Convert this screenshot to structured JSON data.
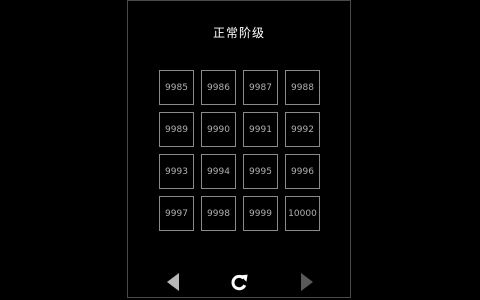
{
  "title": "正常阶级",
  "levels": [
    "9985",
    "9986",
    "9987",
    "9988",
    "9989",
    "9990",
    "9991",
    "9992",
    "9993",
    "9994",
    "9995",
    "9996",
    "9997",
    "9998",
    "9999",
    "10000"
  ],
  "controls": {
    "prev_icon": "triangle-left-icon",
    "reset_icon": "refresh-icon",
    "next_icon": "triangle-right-icon"
  },
  "colors": {
    "background": "#000000",
    "text": "#ffffff",
    "cell_border": "#8a8a8a",
    "cell_text": "#b0b0b0",
    "prev_arrow": "#b8b8b8",
    "reset_icon": "#ffffff",
    "next_arrow": "#5a5a5a"
  }
}
